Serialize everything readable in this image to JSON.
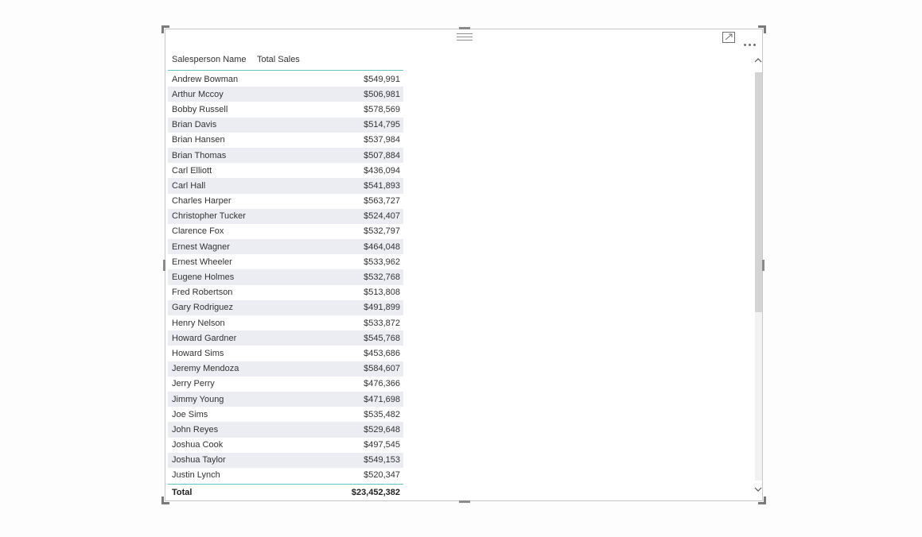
{
  "table": {
    "columns": [
      "Salesperson Name",
      "Total Sales"
    ],
    "rows": [
      {
        "name": "Andrew Bowman",
        "sales": "$549,991"
      },
      {
        "name": "Arthur Mccoy",
        "sales": "$506,981"
      },
      {
        "name": "Bobby Russell",
        "sales": "$578,569"
      },
      {
        "name": "Brian Davis",
        "sales": "$514,795"
      },
      {
        "name": "Brian Hansen",
        "sales": "$537,984"
      },
      {
        "name": "Brian Thomas",
        "sales": "$507,884"
      },
      {
        "name": "Carl Elliott",
        "sales": "$436,094"
      },
      {
        "name": "Carl Hall",
        "sales": "$541,893"
      },
      {
        "name": "Charles Harper",
        "sales": "$563,727"
      },
      {
        "name": "Christopher Tucker",
        "sales": "$524,407"
      },
      {
        "name": "Clarence Fox",
        "sales": "$532,797"
      },
      {
        "name": "Ernest Wagner",
        "sales": "$464,048"
      },
      {
        "name": "Ernest Wheeler",
        "sales": "$533,962"
      },
      {
        "name": "Eugene Holmes",
        "sales": "$532,768"
      },
      {
        "name": "Fred Robertson",
        "sales": "$513,808"
      },
      {
        "name": "Gary Rodriguez",
        "sales": "$491,899"
      },
      {
        "name": "Henry Nelson",
        "sales": "$533,872"
      },
      {
        "name": "Howard Gardner",
        "sales": "$545,768"
      },
      {
        "name": "Howard Sims",
        "sales": "$453,686"
      },
      {
        "name": "Jeremy Mendoza",
        "sales": "$584,607"
      },
      {
        "name": "Jerry Perry",
        "sales": "$476,366"
      },
      {
        "name": "Jimmy Young",
        "sales": "$471,698"
      },
      {
        "name": "Joe Sims",
        "sales": "$535,482"
      },
      {
        "name": "John Reyes",
        "sales": "$529,648"
      },
      {
        "name": "Joshua Cook",
        "sales": "$497,545"
      },
      {
        "name": "Joshua Taylor",
        "sales": "$549,153"
      },
      {
        "name": "Justin Lynch",
        "sales": "$520,347"
      }
    ],
    "total": {
      "label": "Total",
      "value": "$23,452,382"
    }
  },
  "icons": {
    "drag": "drag-handle-icon",
    "focus": "focus-mode-icon",
    "more": "more-options-icon",
    "scroll_up": "chevron-up-icon",
    "scroll_down": "chevron-down-icon"
  },
  "colors": {
    "accent": "#5ec5c5",
    "row_alt": "#ecedf2"
  }
}
